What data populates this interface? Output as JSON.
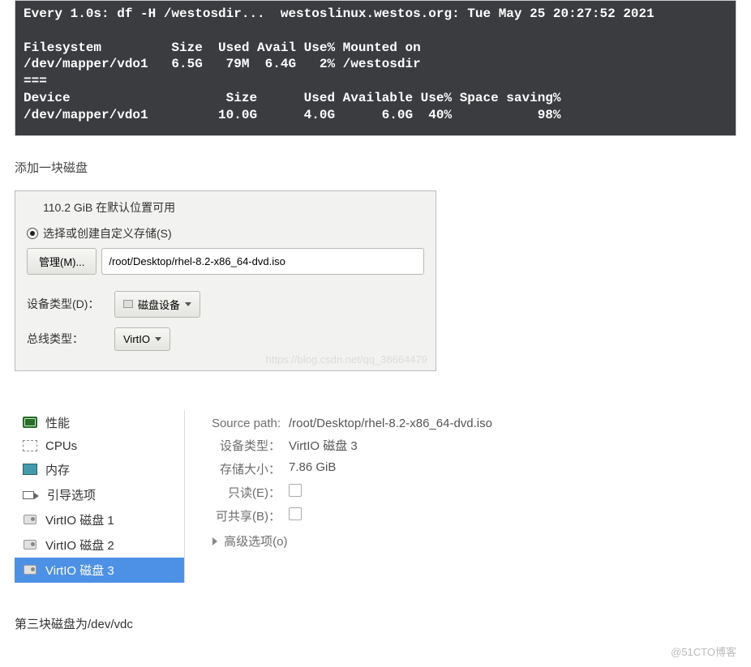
{
  "terminal": {
    "lines": "Every 1.0s: df -H /westosdir...  westoslinux.westos.org: Tue May 25 20:27:52 2021\n\nFilesystem         Size  Used Avail Use% Mounted on\n/dev/mapper/vdo1   6.5G   79M  6.4G   2% /westosdir\n===\nDevice                    Size      Used Available Use% Space saving%\n/dev/mapper/vdo1         10.0G      4.0G      6.0G  40%           98%"
  },
  "caption1": "添加一块磁盘",
  "dialog": {
    "available": "110.2 GiB 在默认位置可用",
    "storage_radio": "选择或创建自定义存储(S)",
    "manage_btn": "管理(M)...",
    "path_value": "/root/Desktop/rhel-8.2-x86_64-dvd.iso",
    "device_type_label": "设备类型(D)：",
    "device_type_value": "磁盘设备",
    "bus_type_label": "总线类型：",
    "bus_type_value": "VirtIO",
    "watermark": "https://blog.csdn.net/qq_38664479"
  },
  "vm": {
    "sidebar": {
      "perf": "性能",
      "cpus": "CPUs",
      "mem": "内存",
      "boot": "引导选项",
      "disk1": "VirtIO 磁盘 1",
      "disk2": "VirtIO 磁盘 2",
      "disk3": "VirtIO 磁盘 3"
    },
    "detail": {
      "src_label": "Source path:",
      "src_val": "/root/Desktop/rhel-8.2-x86_64-dvd.iso",
      "devtype_label": "设备类型：",
      "devtype_val": "VirtIO 磁盘 3",
      "size_label": "存储大小：",
      "size_val": "7.86 GiB",
      "ro_label": "只读(E)：",
      "share_label": "可共享(B)：",
      "adv": "高级选项(o)"
    }
  },
  "footer": "第三块磁盘为/dev/vdc",
  "credit": "@51CTO博客"
}
